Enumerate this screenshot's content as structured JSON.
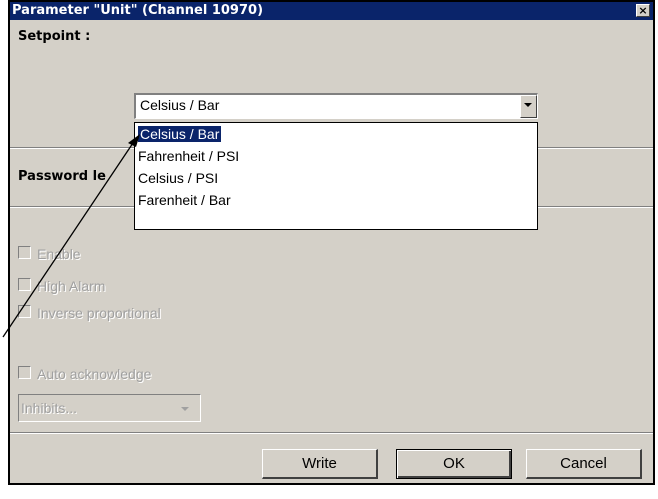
{
  "window": {
    "title": "Parameter \"Unit\" (Channel 10970)",
    "close_glyph": "×"
  },
  "setpoint": {
    "label": "Setpoint :",
    "selected_value": "Celsius / Bar",
    "options": [
      "Celsius / Bar",
      "Fahrenheit / PSI",
      "Celsius / PSI",
      "Farenheit / Bar"
    ],
    "highlighted_index": 0
  },
  "password": {
    "label": "Password le"
  },
  "checkboxes": {
    "enable": "Enable",
    "high_alarm": "High Alarm",
    "inverse_proportional": "Inverse proportional",
    "auto_acknowledge": "Auto acknowledge"
  },
  "inhibits": {
    "value": "Inhibits..."
  },
  "buttons": {
    "write": "Write",
    "ok": "OK",
    "cancel": "Cancel"
  },
  "colors": {
    "dialog_bg": "#d4d0c8",
    "titlebar": "#0a246a",
    "highlight": "#0a246a",
    "disabled_text": "#a0a0a0"
  }
}
